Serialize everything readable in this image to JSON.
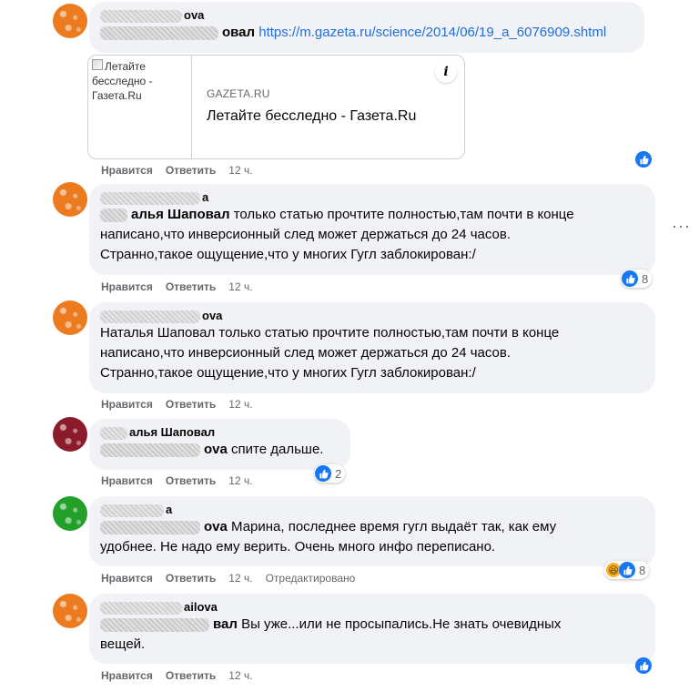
{
  "actions": {
    "like": "Нравится",
    "reply": "Ответить"
  },
  "comments": [
    {
      "author_tail": "ova",
      "mention_tail": "овал",
      "link": "https://m.gazeta.ru/science/2014/06/19_a_6076909.shtml",
      "preview": {
        "thumb_alt": "Летайте бесследно - Газета.Ru",
        "domain": "GAZETA.RU",
        "title": "Летайте бесследно - Газета.Ru",
        "info": "i"
      },
      "time": "12 ч.",
      "reaction_count": ""
    },
    {
      "author_tail": "a",
      "mention_tail": "алья Шаповал",
      "text_lines": [
        "только статью прочтите полностью,там почти в конце",
        "написано,что инверсионный след может держаться до 24 часов.",
        "Странно,такое ощущение,что у многих Гугл заблокирован:/"
      ],
      "time": "12 ч.",
      "reaction_count": "8"
    },
    {
      "author_tail": "ova",
      "mention": "Наталья Шаповал",
      "text_lines": [
        "только статью прочтите полностью,там почти в конце",
        "написано,что инверсионный след может держаться до 24 часов.",
        "Странно,такое ощущение,что у многих Гугл заблокирован:/"
      ],
      "time": "12 ч.",
      "reaction_count": ""
    },
    {
      "author_tail": "алья Шаповал",
      "mention_tail": "ova",
      "text_lines": [
        "спите дальше."
      ],
      "time": "12 ч.",
      "reaction_count": "2"
    },
    {
      "author_tail": "a",
      "mention_tail": "ova",
      "text_lines": [
        "Марина, последнее время гугл выдаёт так, как ему",
        "удобнее. Не надо ему верить. Очень много инфо переписано."
      ],
      "time": "12 ч.",
      "edited": "Отредактировано",
      "reaction_count": "8"
    },
    {
      "author_tail": "ailova",
      "mention_tail": "вал",
      "text_lines": [
        "Вы уже...или не просыпались.Не знать очевидных",
        "вещей."
      ],
      "time": "12 ч.",
      "reaction_count": ""
    }
  ],
  "colors": {
    "bubble": "#f0f2f5",
    "link": "#216fdb",
    "like_blue": "#1877f2",
    "meta_gray": "#65676b"
  },
  "icons": {
    "like": "thumbs-up-icon",
    "haha": "laughing-face-icon",
    "info": "info-icon",
    "more": "more-dots-icon"
  }
}
